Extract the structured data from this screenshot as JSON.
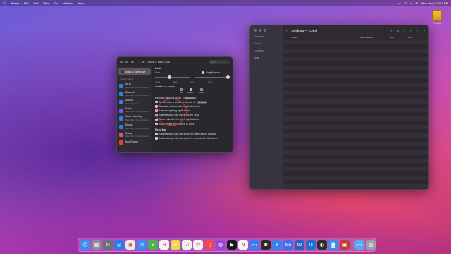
{
  "menubar": {
    "app_name": "Finder",
    "items": [
      "File",
      "Edit",
      "View",
      "Go",
      "Window",
      "Help"
    ],
    "clock": "Mon May 9 10:18 PM"
  },
  "desktop": {
    "disk_label": "PlexBIt"
  },
  "finder": {
    "title": "Desktop — Local",
    "sidebar": [
      "Favorites",
      "iCloud",
      "Locations",
      "Tags"
    ],
    "columns": {
      "name": "Name",
      "date": "Date Modified",
      "size": "Size",
      "kind": "Kind"
    }
  },
  "settings": {
    "title": "Dock & Menu Bar",
    "search_placeholder": "Search",
    "selected": "Dock & Menu Bar",
    "section": "Control Center",
    "items": [
      {
        "name": "Wi-Fi",
        "sub": "Menu Bar & Control Center",
        "color": "#2f7cf6"
      },
      {
        "name": "Bluetooth",
        "sub": "Menu Bar & Control Center",
        "color": "#2f7cf6"
      },
      {
        "name": "AirDrop",
        "sub": "Control Center",
        "color": "#2f7cf6"
      },
      {
        "name": "Focus",
        "sub": "Menu Bar & Control Center",
        "color": "#6c5ce7"
      },
      {
        "name": "Screen Mirroring",
        "sub": "Menu Bar & Control Center",
        "color": "#2f7cf6"
      },
      {
        "name": "Display",
        "sub": "Menu Bar & Control Center",
        "color": "#2f7cf6"
      },
      {
        "name": "Sound",
        "sub": "Menu Bar & Control Center",
        "color": "#e8468a"
      },
      {
        "name": "Now Playing",
        "sub": "",
        "color": "#e0443a"
      }
    ],
    "dock": {
      "heading": "Dock",
      "size_label": "Size:",
      "magnification_label": "Magnification",
      "small": "small",
      "large": "large",
      "min": "min",
      "max": "max",
      "position_label": "Position on screen:",
      "positions": [
        "Left",
        "Bottom",
        "Right"
      ],
      "minimize_label": "Minimize windows using:",
      "minimize_value": "Scale effect",
      "double_click_label": "Double-click a window's title bar to",
      "double_click_value": "minimize",
      "options": [
        "Minimize windows into application icon",
        "Animate opening applications",
        "Automatically hide and show the Dock",
        "Show indicators for open applications",
        "Show recent applications in Dock"
      ]
    },
    "menu_bar": {
      "heading": "Menu Bar",
      "options": [
        "Automatically hide and show the menu bar on desktop",
        "Automatically hide and show the menu bar in full screen"
      ]
    }
  },
  "dock_apps": [
    {
      "name": "finder-icon",
      "color": "#3d8ef0",
      "glyph": "☺"
    },
    {
      "name": "launchpad-icon",
      "color": "#8a8f9c",
      "glyph": "▦"
    },
    {
      "name": "system-preferences-icon",
      "color": "#6b6f78",
      "glyph": "⚙"
    },
    {
      "name": "safari-icon",
      "color": "#2a7ae8",
      "glyph": "◎"
    },
    {
      "name": "chrome-icon",
      "color": "#e8e8e8",
      "glyph": "◉"
    },
    {
      "name": "mail-icon",
      "color": "#3b8bf2",
      "glyph": "✉"
    },
    {
      "name": "maps-icon",
      "color": "#4fb04f",
      "glyph": "⌖"
    },
    {
      "name": "calendar-icon",
      "color": "#f3f3f3",
      "glyph": "9"
    },
    {
      "name": "notes-icon",
      "color": "#f5d547",
      "glyph": "≡"
    },
    {
      "name": "reminders-icon",
      "color": "#f0f0f0",
      "glyph": "☑"
    },
    {
      "name": "photos-icon",
      "color": "#f2f2f2",
      "glyph": "✿"
    },
    {
      "name": "music-icon",
      "color": "#f0465b",
      "glyph": "♫"
    },
    {
      "name": "podcasts-icon",
      "color": "#9b45d8",
      "glyph": "◍"
    },
    {
      "name": "tv-icon",
      "color": "#1c1c1e",
      "glyph": "▶"
    },
    {
      "name": "news-icon",
      "color": "#f5f5f5",
      "glyph": "N"
    },
    {
      "name": "keynote-icon",
      "color": "#3a7bf0",
      "glyph": "▭"
    },
    {
      "name": "chatgpt-icon",
      "color": "#2a2a2a",
      "glyph": "✺"
    },
    {
      "name": "things-icon",
      "color": "#3a80f0",
      "glyph": "✔"
    },
    {
      "name": "messenger-icon",
      "color": "#3a6ff0",
      "glyph": "Me"
    },
    {
      "name": "word-icon",
      "color": "#2b5fc2",
      "glyph": "W"
    },
    {
      "name": "outlook-icon",
      "color": "#1f6ed4",
      "glyph": "O"
    },
    {
      "name": "obs-icon",
      "color": "#2d2d30",
      "glyph": "◐"
    },
    {
      "name": "zoom-icon",
      "color": "#3a8cf5",
      "glyph": "◙"
    },
    {
      "name": "photo-booth-icon",
      "color": "#c23a3a",
      "glyph": "▣"
    }
  ],
  "dock_right": [
    {
      "name": "folder-icon",
      "color": "#5aa7f5",
      "glyph": "▭"
    },
    {
      "name": "trash-icon",
      "color": "#9aa0aa",
      "glyph": "▥"
    }
  ]
}
